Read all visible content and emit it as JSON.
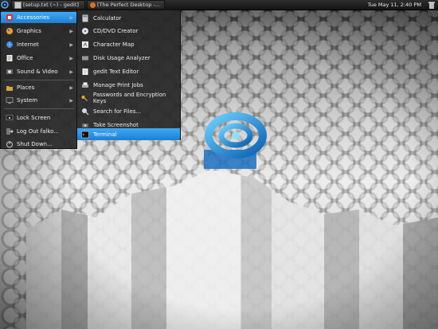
{
  "panel": {
    "tasks": [
      {
        "label": "[setup.txt (~) - gedit]"
      },
      {
        "label": "[The Perfect Desktop -..."
      }
    ],
    "clock": "Tue May 11,  2:40 PM"
  },
  "menu": {
    "items": [
      {
        "label": "Accessories",
        "icon": "accessories-icon",
        "active": true
      },
      {
        "label": "Graphics",
        "icon": "graphics-icon"
      },
      {
        "label": "Internet",
        "icon": "internet-icon"
      },
      {
        "label": "Office",
        "icon": "office-icon"
      },
      {
        "label": "Sound & Video",
        "icon": "sound-video-icon"
      },
      {
        "label": "Places",
        "icon": "places-icon"
      },
      {
        "label": "System",
        "icon": "system-icon"
      },
      {
        "label": "Lock Screen",
        "icon": "lock-screen-icon"
      },
      {
        "label": "Log Out falko...",
        "icon": "logout-icon"
      },
      {
        "label": "Shut Down...",
        "icon": "shutdown-icon"
      }
    ]
  },
  "submenu": {
    "items": [
      {
        "label": "Calculator",
        "icon": "calculator-icon"
      },
      {
        "label": "CD/DVD Creator",
        "icon": "cd-dvd-icon"
      },
      {
        "label": "Character Map",
        "icon": "character-map-icon"
      },
      {
        "label": "Disk Usage Analyzer",
        "icon": "disk-usage-icon"
      },
      {
        "label": "gedit Text Editor",
        "icon": "text-editor-icon"
      },
      {
        "label": "Manage Print Jobs",
        "icon": "printer-icon"
      },
      {
        "label": "Passwords and Encryption Keys",
        "icon": "keys-icon"
      },
      {
        "label": "Search for Files...",
        "icon": "search-icon"
      },
      {
        "label": "Take Screenshot",
        "icon": "camera-icon"
      },
      {
        "label": "Terminal",
        "icon": "terminal-icon",
        "active": true
      }
    ]
  },
  "colors": {
    "highlight": "#2b95e8",
    "panel": "#1c1c1c",
    "menu_bg": "#282828"
  }
}
